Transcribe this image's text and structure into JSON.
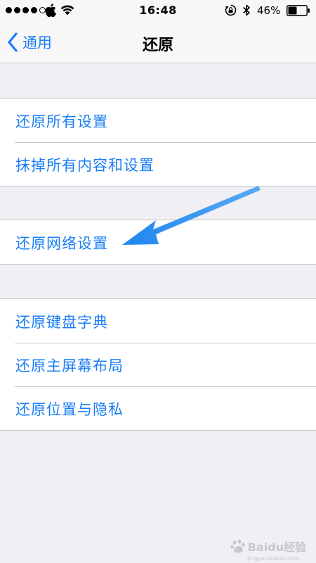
{
  "status_bar": {
    "time": "16:48",
    "battery_percent": "46%",
    "battery_level": 0.46,
    "signal_strength": 4,
    "signal_max": 5
  },
  "nav": {
    "back_label": "通用",
    "title": "还原"
  },
  "groups": [
    {
      "items": [
        "还原所有设置",
        "抹掉所有内容和设置"
      ]
    },
    {
      "items": [
        "还原网络设置"
      ]
    },
    {
      "items": [
        "还原键盘字典",
        "还原主屏幕布局",
        "还原位置与隐私"
      ]
    }
  ],
  "watermark": {
    "text": "Baidu经验",
    "subtext": "jingyan.baidu.com"
  },
  "colors": {
    "accent": "#1a7ef5",
    "annotation_arrow": "#2a8df0"
  }
}
